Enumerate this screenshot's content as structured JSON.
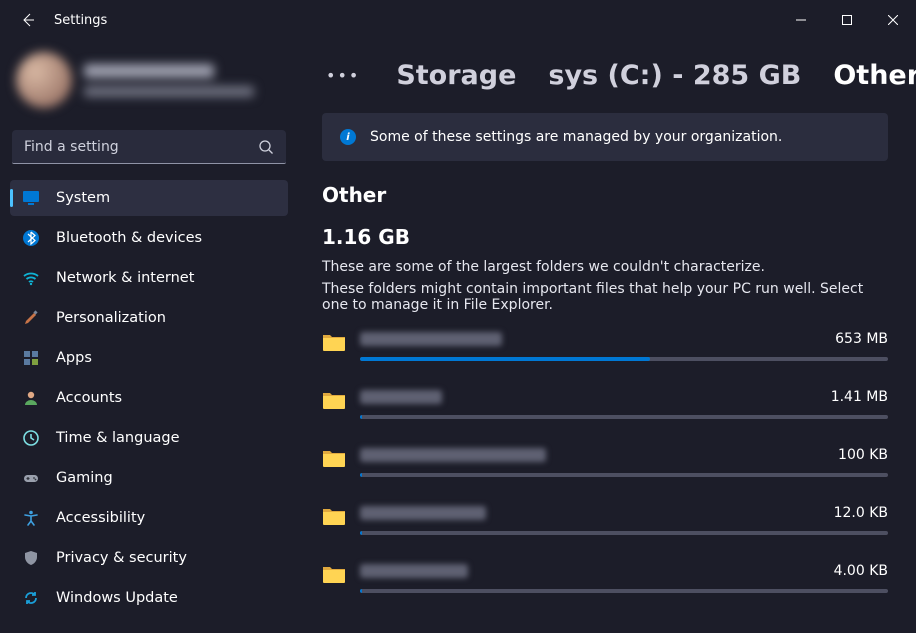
{
  "titlebar": {
    "title": "Settings"
  },
  "search": {
    "placeholder": "Find a setting"
  },
  "sidebar": {
    "items": [
      {
        "label": "System",
        "icon": "monitor",
        "active": true
      },
      {
        "label": "Bluetooth & devices",
        "icon": "bluetooth",
        "active": false
      },
      {
        "label": "Network & internet",
        "icon": "wifi",
        "active": false
      },
      {
        "label": "Personalization",
        "icon": "brush",
        "active": false
      },
      {
        "label": "Apps",
        "icon": "apps",
        "active": false
      },
      {
        "label": "Accounts",
        "icon": "person",
        "active": false
      },
      {
        "label": "Time & language",
        "icon": "clock",
        "active": false
      },
      {
        "label": "Gaming",
        "icon": "gamepad",
        "active": false
      },
      {
        "label": "Accessibility",
        "icon": "accessibility",
        "active": false
      },
      {
        "label": "Privacy & security",
        "icon": "shield",
        "active": false
      },
      {
        "label": "Windows Update",
        "icon": "update",
        "active": false
      }
    ]
  },
  "breadcrumb": {
    "ellipsis": "•••",
    "items": [
      {
        "label": "Storage"
      },
      {
        "label": "sys (C:) - 285 GB"
      },
      {
        "label": "Other",
        "current": true
      }
    ]
  },
  "notice": {
    "text": "Some of these settings are managed by your organization."
  },
  "page": {
    "heading": "Other",
    "total": "1.16 GB",
    "desc1": "These are some of the largest folders we couldn't characterize.",
    "desc2": "These folders might contain important files that help your PC run well. Select one to manage it in File Explorer."
  },
  "folders": [
    {
      "size": "653 MB",
      "nameWidth": 142,
      "fillPct": 55
    },
    {
      "size": "1.41 MB",
      "nameWidth": 82,
      "fillPct": 0.3
    },
    {
      "size": "100 KB",
      "nameWidth": 186,
      "fillPct": 0.3
    },
    {
      "size": "12.0 KB",
      "nameWidth": 126,
      "fillPct": 0.3
    },
    {
      "size": "4.00 KB",
      "nameWidth": 108,
      "fillPct": 0.3
    }
  ]
}
